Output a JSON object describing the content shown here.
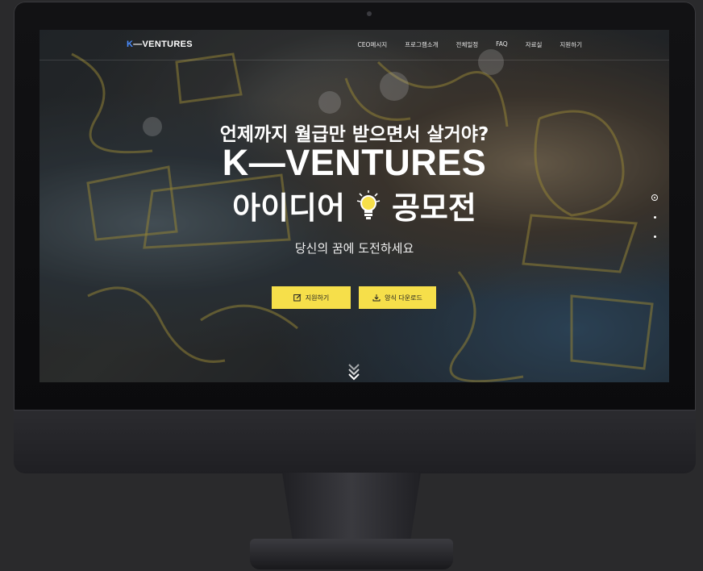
{
  "site": {
    "logo": {
      "k": "K",
      "rest": "—VENTURES"
    },
    "nav": [
      "CEO메시지",
      "프로그램소개",
      "전체일정",
      "FAQ",
      "자료실",
      "지원하기"
    ]
  },
  "hero": {
    "line1": "언제까지 월급만 받으면서 살거야?",
    "title": "K—VENTURES",
    "line3_left": "아이디어",
    "line3_right": "공모전",
    "subtitle": "당신의 꿈에 도전하세요",
    "buttons": {
      "apply": "지원하기",
      "download": "양식 다운로드"
    }
  },
  "pager": {
    "slides": 3,
    "active": 1
  },
  "icons": [
    "lightbulb-icon",
    "edit-icon",
    "download-icon",
    "chevron-double-down-icon"
  ],
  "colors": {
    "accent": "#f6df4a",
    "logo_k": "#4a8cff",
    "text": "#ffffff"
  }
}
